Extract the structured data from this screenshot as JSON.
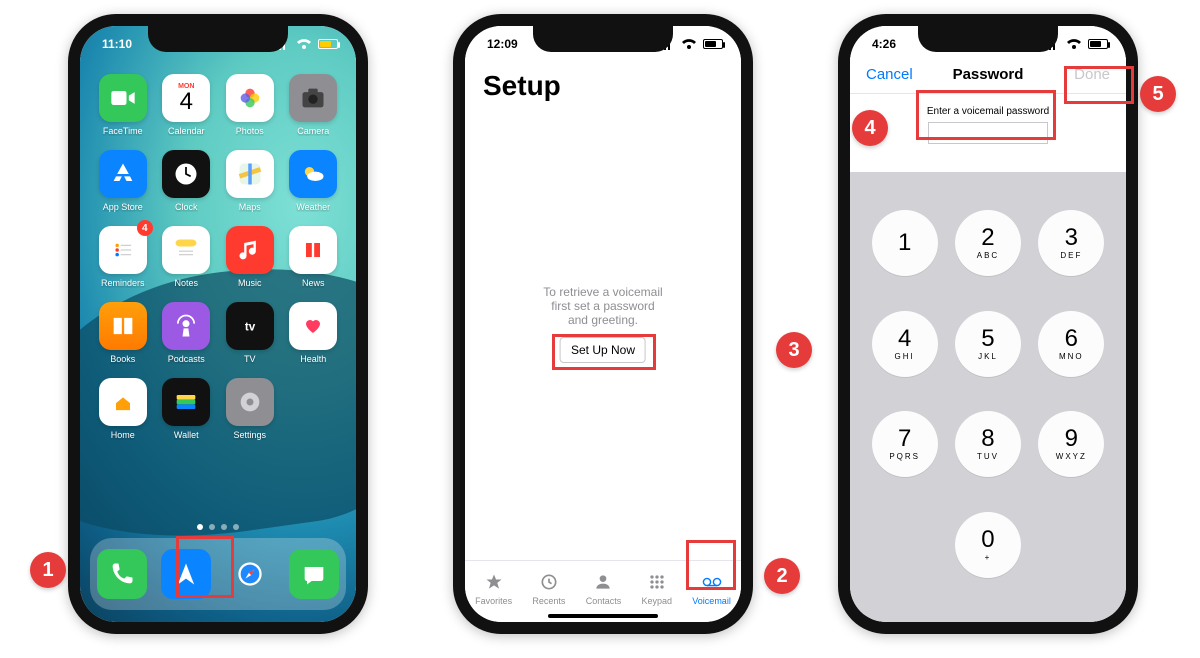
{
  "phone1": {
    "time": "11:10",
    "apps": [
      {
        "label": "FaceTime",
        "color": "bg-green",
        "icon": "video"
      },
      {
        "label": "Calendar",
        "color": "",
        "icon": "calendar",
        "cal": {
          "day": "MON",
          "num": "4"
        }
      },
      {
        "label": "Photos",
        "color": "",
        "icon": "photos"
      },
      {
        "label": "Camera",
        "color": "bg-grey",
        "icon": "camera"
      },
      {
        "label": "App Store",
        "color": "bg-blue",
        "icon": "appstore"
      },
      {
        "label": "Clock",
        "color": "bg-black",
        "icon": "clock"
      },
      {
        "label": "Maps",
        "color": "",
        "icon": "maps"
      },
      {
        "label": "Weather",
        "color": "bg-blue",
        "icon": "weather"
      },
      {
        "label": "Reminders",
        "color": "",
        "icon": "reminders",
        "badge": "4"
      },
      {
        "label": "Notes",
        "color": "",
        "icon": "notes"
      },
      {
        "label": "Music",
        "color": "bg-red",
        "icon": "music"
      },
      {
        "label": "News",
        "color": "",
        "icon": "news"
      },
      {
        "label": "Books",
        "color": "bg-orange",
        "icon": "books"
      },
      {
        "label": "Podcasts",
        "color": "bg-purple",
        "icon": "podcasts"
      },
      {
        "label": "TV",
        "color": "bg-black",
        "icon": "tv"
      },
      {
        "label": "Health",
        "color": "",
        "icon": "health"
      },
      {
        "label": "Home",
        "color": "",
        "icon": "home"
      },
      {
        "label": "Wallet",
        "color": "bg-black",
        "icon": "wallet"
      },
      {
        "label": "Settings",
        "color": "bg-grey",
        "icon": "settings"
      }
    ],
    "dock": [
      {
        "name": "phone",
        "color": "bg-green",
        "icon": "phone"
      },
      {
        "name": "arrow",
        "color": "bg-blue",
        "icon": "navigate"
      },
      {
        "name": "safari",
        "color": "",
        "icon": "safari"
      },
      {
        "name": "messages",
        "color": "bg-green",
        "icon": "messages"
      }
    ]
  },
  "phone2": {
    "time": "12:09",
    "title": "Setup",
    "message_line1": "To retrieve a voicemail",
    "message_line2": "first set a password",
    "message_line3": "and greeting.",
    "button": "Set Up Now",
    "tabs": [
      {
        "label": "Favorites",
        "icon": "star"
      },
      {
        "label": "Recents",
        "icon": "clock"
      },
      {
        "label": "Contacts",
        "icon": "person"
      },
      {
        "label": "Keypad",
        "icon": "keypad"
      },
      {
        "label": "Voicemail",
        "icon": "voicemail",
        "active": true
      }
    ]
  },
  "phone3": {
    "time": "4:26",
    "nav_cancel": "Cancel",
    "nav_title": "Password",
    "nav_done": "Done",
    "prompt": "Enter a voicemail password",
    "keys": [
      {
        "n": "1",
        "l": ""
      },
      {
        "n": "2",
        "l": "ABC"
      },
      {
        "n": "3",
        "l": "DEF"
      },
      {
        "n": "4",
        "l": "GHI"
      },
      {
        "n": "5",
        "l": "JKL"
      },
      {
        "n": "6",
        "l": "MNO"
      },
      {
        "n": "7",
        "l": "PQRS"
      },
      {
        "n": "8",
        "l": "TUV"
      },
      {
        "n": "9",
        "l": "WXYZ"
      },
      {
        "n": "",
        "l": "",
        "blank": true
      },
      {
        "n": "0",
        "l": "+"
      },
      {
        "n": "",
        "l": "",
        "blank": true
      }
    ]
  },
  "callouts": {
    "c1": "1",
    "c2": "2",
    "c3": "3",
    "c4": "4",
    "c5": "5"
  }
}
